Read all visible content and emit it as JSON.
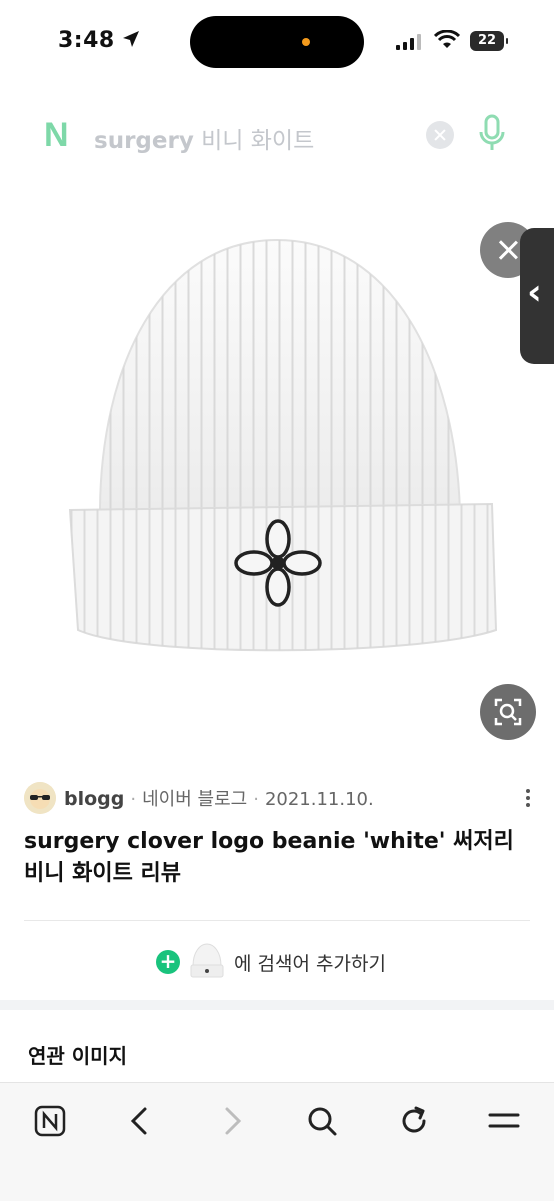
{
  "status": {
    "time": "3:48",
    "battery": "22"
  },
  "search": {
    "query_bold": "surgery",
    "query_rest": " 비니 화이트"
  },
  "post": {
    "blog_name": "blogg",
    "source": "네이버 블로그",
    "date": "2021.11.10.",
    "title": "surgery clover logo beanie 'white' 써저리 비니 화이트 리뷰"
  },
  "add_keyword": {
    "label": "에 검색어 추가하기"
  },
  "related": {
    "heading": "연관 이미지"
  },
  "colors": {
    "naver_green": "#19c37d",
    "faded_green": "#7ed8a8"
  },
  "icons": {
    "back": "chevron-left-icon",
    "forward": "chevron-right-icon",
    "search": "search-icon",
    "refresh": "refresh-icon",
    "menu": "menu-icon"
  }
}
